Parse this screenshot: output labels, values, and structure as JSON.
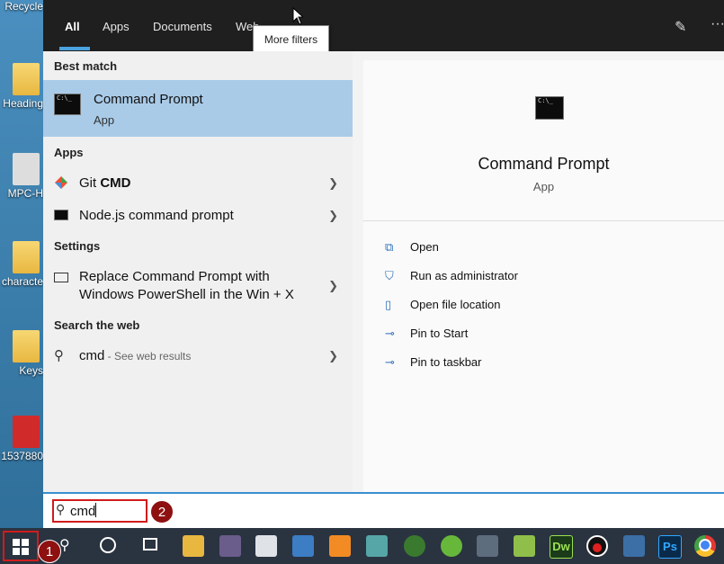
{
  "tabs": {
    "all": "All",
    "apps": "Apps",
    "documents": "Documents",
    "web": "Web"
  },
  "tooltip": "More filters",
  "sections": {
    "best": "Best match",
    "apps": "Apps",
    "settings": "Settings",
    "web": "Search the web"
  },
  "best_match": {
    "title": "Command Prompt",
    "subtitle": "App"
  },
  "apps": {
    "git_prefix": "Git ",
    "git_bold": "CMD",
    "node": "Node.js command prompt"
  },
  "settings": {
    "line1": "Replace Command Prompt with",
    "line2": "Windows PowerShell in the Win + X"
  },
  "web": {
    "query": "cmd",
    "suffix": " - See web results"
  },
  "detail": {
    "title": "Command Prompt",
    "subtitle": "App",
    "actions": [
      "Open",
      "Run as administrator",
      "Open file location",
      "Pin to Start",
      "Pin to taskbar"
    ]
  },
  "search": {
    "value": "cmd"
  },
  "badges": {
    "one": "1",
    "two": "2"
  },
  "taskbar": {
    "dw": "Dw",
    "ps": "Ps"
  },
  "desktop_labels": [
    "Recycle",
    "Heading",
    "MPC-H",
    "characte",
    "Keys",
    "1537880"
  ],
  "colors": {
    "accent": "#4aa3df",
    "selection": "#a9cbe8",
    "badge": "#8e1010",
    "highlight": "#d01c1c"
  }
}
